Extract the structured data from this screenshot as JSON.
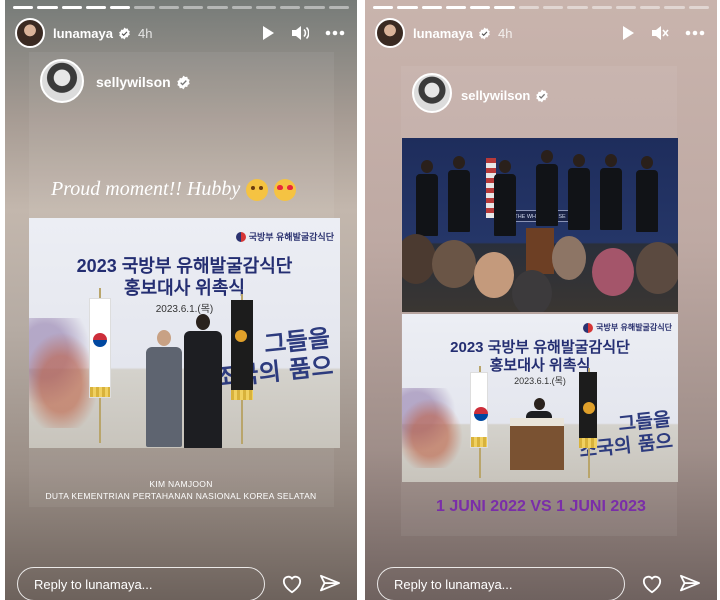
{
  "left_story": {
    "header": {
      "username": "lunamaya",
      "time": "4h"
    },
    "card": {
      "username": "sellywilson"
    },
    "caption": "Proud moment!! Hubby",
    "caption_emojis": [
      "face-blowing-kiss-emoji",
      "heart-eyes-emoji"
    ],
    "photo": {
      "logo_text": "국방부 유해발굴감식단",
      "title_line1": "2023 국방부 유해발굴감식단",
      "title_line2": "홍보대사 위촉식",
      "date": "2023.6.1.(목)",
      "calligraphy": [
        "그들을",
        "조국의 품으"
      ]
    },
    "credit": [
      "KIM NAMJOON",
      "DUTA KEMENTRIAN PERTAHANAN NASIONAL KOREA SELATAN"
    ],
    "footer": {
      "reply_placeholder": "Reply to lunamaya..."
    }
  },
  "right_story": {
    "header": {
      "username": "lunamaya",
      "time": "4h"
    },
    "card": {
      "username": "sellywilson"
    },
    "briefing": {
      "sign_text": "THE WHITE HOUSE"
    },
    "photo": {
      "logo_text": "국방부 유해발굴감식단",
      "title_line1": "2023 국방부 유해발굴감식단",
      "title_line2": "홍보대사 위촉식",
      "date": "2023.6.1.(목)",
      "calligraphy": [
        "그들을",
        "조국의 품으"
      ]
    },
    "comparison": "1 JUNI 2022 VS 1 JUNI 2023",
    "footer": {
      "reply_placeholder": "Reply to lunamaya..."
    }
  },
  "colors": {
    "comparison_text": "#7a2ea8",
    "photo_title": "#242e72"
  }
}
